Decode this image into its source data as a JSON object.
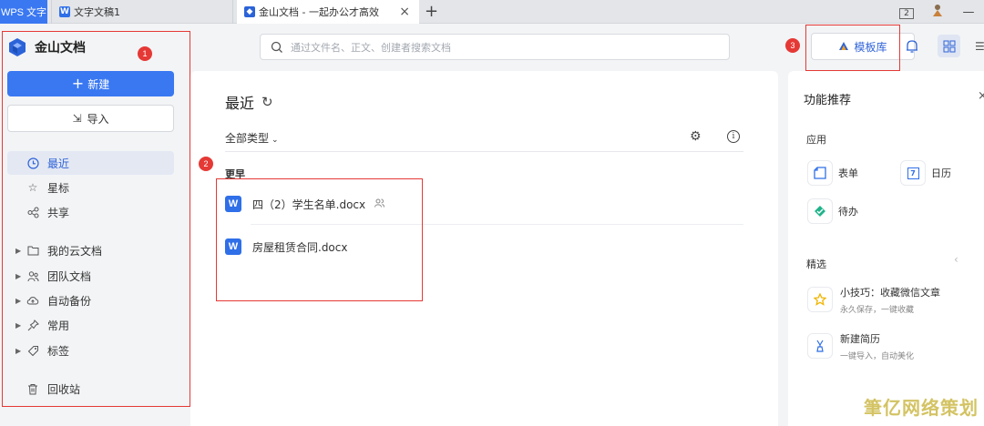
{
  "tabs": {
    "wps_label": "WPS 文字",
    "doc1_label": "文字文稿1",
    "active_label": "金山文档 - 一起办公才高效",
    "close_glyph": "×",
    "add_glyph": "+"
  },
  "window": {
    "panel_badge": "2",
    "minimize_glyph": "—"
  },
  "sidebar": {
    "brand": "金山文档",
    "new_label": "新建",
    "import_label": "导入",
    "items": [
      {
        "label": "最近",
        "icon": "clock-icon",
        "active": true
      },
      {
        "label": "星标",
        "icon": "star-icon"
      },
      {
        "label": "共享",
        "icon": "share-icon"
      },
      {
        "label": "我的云文档",
        "icon": "folder-icon",
        "expandable": true
      },
      {
        "label": "团队文档",
        "icon": "team-icon",
        "expandable": true
      },
      {
        "label": "自动备份",
        "icon": "cloud-backup-icon",
        "expandable": true
      },
      {
        "label": "常用",
        "icon": "pin-icon",
        "expandable": true
      },
      {
        "label": "标签",
        "icon": "tag-icon",
        "expandable": true
      },
      {
        "label": "回收站",
        "icon": "trash-icon"
      }
    ]
  },
  "search": {
    "placeholder": "通过文件名、正文、创建者搜索文档"
  },
  "header": {
    "template_label": "模板库"
  },
  "main": {
    "title": "最近",
    "filter_label": "全部类型",
    "section_label": "更早",
    "files": [
      {
        "name": "四（2）学生名单.docx",
        "shared": true
      },
      {
        "name": "房屋租赁合同.docx",
        "shared": false
      }
    ]
  },
  "right_panel": {
    "title": "功能推荐",
    "apps_label": "应用",
    "apps": [
      {
        "label": "表单",
        "icon": "form-icon",
        "color": "#2f6fe8"
      },
      {
        "label": "日历",
        "icon": "calendar-icon",
        "color": "#2f6fe8",
        "glyph": "7"
      },
      {
        "label": "待办",
        "icon": "todo-icon",
        "color": "#20b38a"
      }
    ],
    "picks_label": "精选",
    "picks": [
      {
        "title": "小技巧：收藏微信文章",
        "subtitle": "永久保存，一键收藏",
        "icon": "star-tip-icon",
        "color": "#f0b400"
      },
      {
        "title": "新建简历",
        "subtitle": "一键导入，自动美化",
        "icon": "resume-icon",
        "color": "#2f6fe8"
      }
    ]
  },
  "annotations": {
    "badge1": "1",
    "badge2": "2",
    "badge3": "3",
    "color": "#e53935"
  },
  "watermark": "筆亿网络策划",
  "colors": {
    "accent": "#3a78f2",
    "active_bg": "#e3e8f3"
  }
}
